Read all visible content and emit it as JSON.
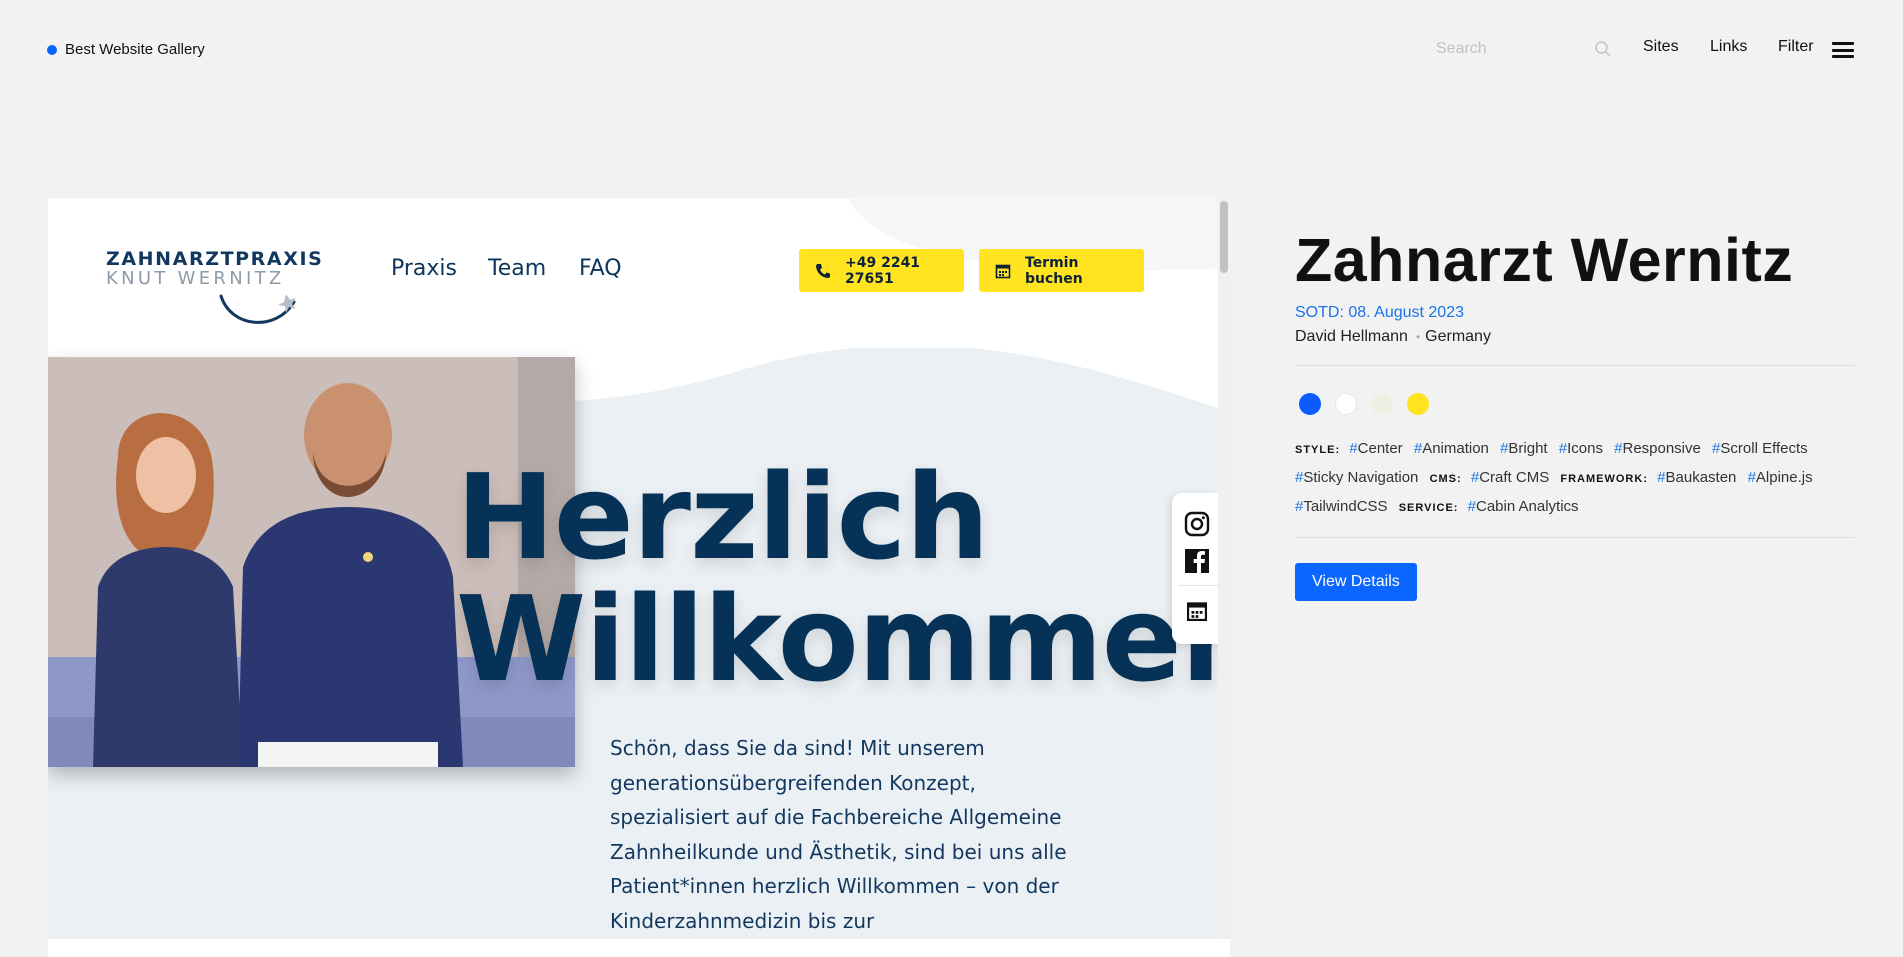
{
  "topbar": {
    "brand": "Best Website Gallery",
    "search_placeholder": "Search",
    "nav": [
      "Sites",
      "Links",
      "Filter"
    ]
  },
  "preview": {
    "logo_line1": "ZAHNARZTPRAXIS",
    "logo_line2": "KNUT WERNITZ",
    "nav": [
      "Praxis",
      "Team",
      "FAQ"
    ],
    "phone_button": "+49 2241 27651",
    "booking_button": "Termin buchen",
    "headline_line1": "Herzlich",
    "headline_line2": "Willkommen",
    "intro": "Schön, dass Sie da sind! Mit unserem generationsübergreifenden Konzept, spezialisiert auf die Fachbereiche Allgemeine Zahnheilkunde und Ästhetik, sind bei uns alle Patient*innen herzlich Willkommen – von der Kinderzahnmedizin bis zur",
    "social": [
      "instagram-icon",
      "facebook-icon",
      "calendar-icon"
    ]
  },
  "details": {
    "title": "Zahnarzt Wernitz",
    "sotd": "SOTD: 08. August 2023",
    "author": "David Hellmann",
    "country": "Germany",
    "colors": [
      "#0a5cff",
      "#ffffff",
      "#efefe4",
      "#ffe41f"
    ],
    "tag_groups": [
      {
        "label": "STYLE:",
        "tags": [
          "Center",
          "Animation",
          "Bright",
          "Icons",
          "Responsive",
          "Scroll Effects",
          "Sticky Navigation"
        ]
      },
      {
        "label": "CMS:",
        "tags": [
          "Craft CMS"
        ]
      },
      {
        "label": "FRAMEWORK:",
        "tags": [
          "Baukasten",
          "Alpine.js",
          "TailwindCSS"
        ]
      },
      {
        "label": "SERVICE:",
        "tags": [
          "Cabin Analytics"
        ]
      }
    ],
    "view_button": "View Details"
  }
}
